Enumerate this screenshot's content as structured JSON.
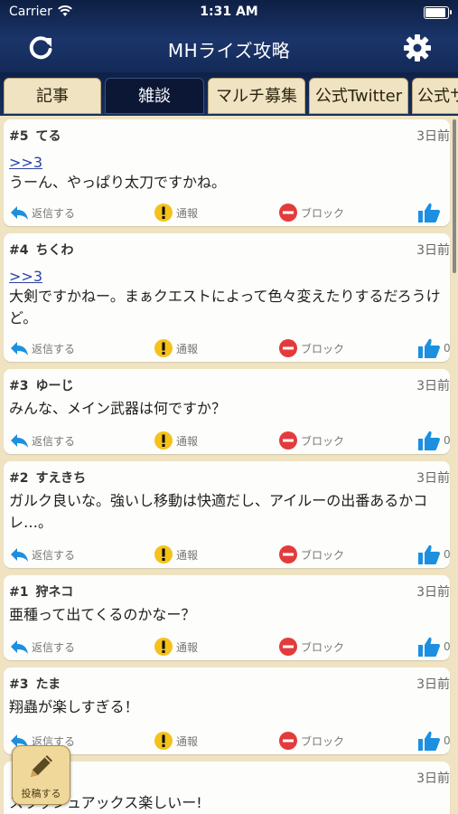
{
  "status_bar": {
    "carrier": "Carrier",
    "time": "1:31 AM"
  },
  "nav": {
    "title": "MHライズ攻略",
    "refresh_icon": "refresh-icon",
    "settings_icon": "gear-icon"
  },
  "tabs": [
    {
      "label": "記事"
    },
    {
      "label": "雑談",
      "active": true
    },
    {
      "label": "マルチ募集"
    },
    {
      "label": "公式Twitter"
    },
    {
      "label": "公式サ"
    }
  ],
  "posts": [
    {
      "num": "#5",
      "name": "てる",
      "date": "3日前",
      "anchor": ">>3",
      "body": "うーん、やっぱり太刀ですかね。",
      "likes": ""
    },
    {
      "num": "#4",
      "name": "ちくわ",
      "date": "3日前",
      "anchor": ">>3",
      "body": "大剣ですかねー。まぁクエストによって色々変えたりするだろうけど。",
      "likes": "0"
    },
    {
      "num": "#3",
      "name": "ゆーじ",
      "date": "3日前",
      "anchor": "",
      "body": "みんな、メイン武器は何ですか？",
      "likes": "0"
    },
    {
      "num": "#2",
      "name": "すえきち",
      "date": "3日前",
      "anchor": "",
      "body": "ガルク良いな。強いし移動は快適だし、アイルーの出番あるかコレ…。",
      "likes": "0"
    },
    {
      "num": "#1",
      "name": "狩ネコ",
      "date": "3日前",
      "anchor": "",
      "body": "亜種って出てくるのかなー？",
      "likes": "0"
    },
    {
      "num": "#3",
      "name": "たま",
      "date": "3日前",
      "anchor": "",
      "body": "翔蟲が楽しすぎる！",
      "likes": "0"
    },
    {
      "num": "",
      "name": "",
      "date": "3日前",
      "anchor": "",
      "body": "スラッシュアックス楽しいー!",
      "likes": ""
    }
  ],
  "actions": {
    "reply": "返信する",
    "report": "通報",
    "block": "ブロック"
  },
  "post_button": {
    "label": "投稿する"
  }
}
